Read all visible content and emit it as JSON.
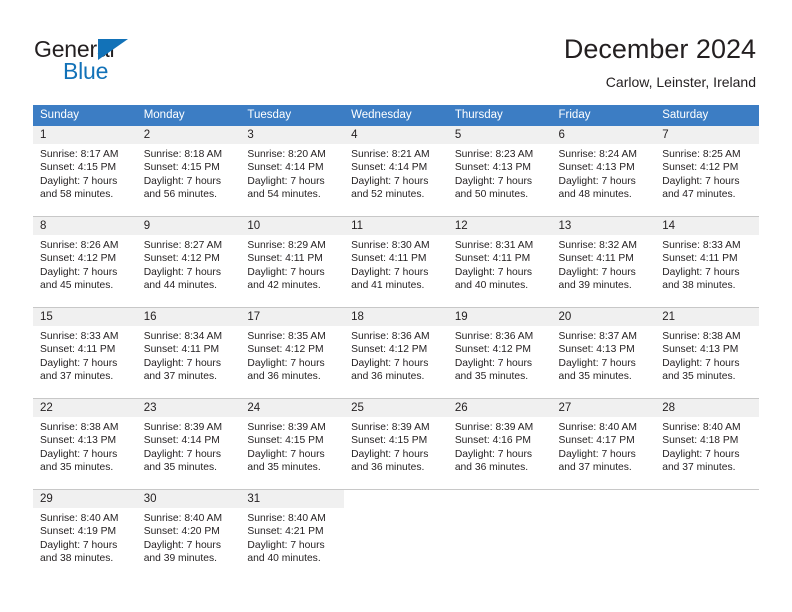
{
  "logo": {
    "word_top": "General",
    "word_bottom": "Blue",
    "triangle_color": "#1272b8"
  },
  "header": {
    "title": "December 2024",
    "subtitle": "Carlow, Leinster, Ireland"
  },
  "theme": {
    "header_row_bg": "#3c7dc4",
    "daynum_bg": "#f0f0f0",
    "text": "#231f20",
    "separator": "#c8c8c8"
  },
  "weekdays": [
    "Sunday",
    "Monday",
    "Tuesday",
    "Wednesday",
    "Thursday",
    "Friday",
    "Saturday"
  ],
  "weeks": [
    [
      {
        "day": "1",
        "sunrise": "Sunrise: 8:17 AM",
        "sunset": "Sunset: 4:15 PM",
        "daylight1": "Daylight: 7 hours",
        "daylight2": "and 58 minutes."
      },
      {
        "day": "2",
        "sunrise": "Sunrise: 8:18 AM",
        "sunset": "Sunset: 4:15 PM",
        "daylight1": "Daylight: 7 hours",
        "daylight2": "and 56 minutes."
      },
      {
        "day": "3",
        "sunrise": "Sunrise: 8:20 AM",
        "sunset": "Sunset: 4:14 PM",
        "daylight1": "Daylight: 7 hours",
        "daylight2": "and 54 minutes."
      },
      {
        "day": "4",
        "sunrise": "Sunrise: 8:21 AM",
        "sunset": "Sunset: 4:14 PM",
        "daylight1": "Daylight: 7 hours",
        "daylight2": "and 52 minutes."
      },
      {
        "day": "5",
        "sunrise": "Sunrise: 8:23 AM",
        "sunset": "Sunset: 4:13 PM",
        "daylight1": "Daylight: 7 hours",
        "daylight2": "and 50 minutes."
      },
      {
        "day": "6",
        "sunrise": "Sunrise: 8:24 AM",
        "sunset": "Sunset: 4:13 PM",
        "daylight1": "Daylight: 7 hours",
        "daylight2": "and 48 minutes."
      },
      {
        "day": "7",
        "sunrise": "Sunrise: 8:25 AM",
        "sunset": "Sunset: 4:12 PM",
        "daylight1": "Daylight: 7 hours",
        "daylight2": "and 47 minutes."
      }
    ],
    [
      {
        "day": "8",
        "sunrise": "Sunrise: 8:26 AM",
        "sunset": "Sunset: 4:12 PM",
        "daylight1": "Daylight: 7 hours",
        "daylight2": "and 45 minutes."
      },
      {
        "day": "9",
        "sunrise": "Sunrise: 8:27 AM",
        "sunset": "Sunset: 4:12 PM",
        "daylight1": "Daylight: 7 hours",
        "daylight2": "and 44 minutes."
      },
      {
        "day": "10",
        "sunrise": "Sunrise: 8:29 AM",
        "sunset": "Sunset: 4:11 PM",
        "daylight1": "Daylight: 7 hours",
        "daylight2": "and 42 minutes."
      },
      {
        "day": "11",
        "sunrise": "Sunrise: 8:30 AM",
        "sunset": "Sunset: 4:11 PM",
        "daylight1": "Daylight: 7 hours",
        "daylight2": "and 41 minutes."
      },
      {
        "day": "12",
        "sunrise": "Sunrise: 8:31 AM",
        "sunset": "Sunset: 4:11 PM",
        "daylight1": "Daylight: 7 hours",
        "daylight2": "and 40 minutes."
      },
      {
        "day": "13",
        "sunrise": "Sunrise: 8:32 AM",
        "sunset": "Sunset: 4:11 PM",
        "daylight1": "Daylight: 7 hours",
        "daylight2": "and 39 minutes."
      },
      {
        "day": "14",
        "sunrise": "Sunrise: 8:33 AM",
        "sunset": "Sunset: 4:11 PM",
        "daylight1": "Daylight: 7 hours",
        "daylight2": "and 38 minutes."
      }
    ],
    [
      {
        "day": "15",
        "sunrise": "Sunrise: 8:33 AM",
        "sunset": "Sunset: 4:11 PM",
        "daylight1": "Daylight: 7 hours",
        "daylight2": "and 37 minutes."
      },
      {
        "day": "16",
        "sunrise": "Sunrise: 8:34 AM",
        "sunset": "Sunset: 4:11 PM",
        "daylight1": "Daylight: 7 hours",
        "daylight2": "and 37 minutes."
      },
      {
        "day": "17",
        "sunrise": "Sunrise: 8:35 AM",
        "sunset": "Sunset: 4:12 PM",
        "daylight1": "Daylight: 7 hours",
        "daylight2": "and 36 minutes."
      },
      {
        "day": "18",
        "sunrise": "Sunrise: 8:36 AM",
        "sunset": "Sunset: 4:12 PM",
        "daylight1": "Daylight: 7 hours",
        "daylight2": "and 36 minutes."
      },
      {
        "day": "19",
        "sunrise": "Sunrise: 8:36 AM",
        "sunset": "Sunset: 4:12 PM",
        "daylight1": "Daylight: 7 hours",
        "daylight2": "and 35 minutes."
      },
      {
        "day": "20",
        "sunrise": "Sunrise: 8:37 AM",
        "sunset": "Sunset: 4:13 PM",
        "daylight1": "Daylight: 7 hours",
        "daylight2": "and 35 minutes."
      },
      {
        "day": "21",
        "sunrise": "Sunrise: 8:38 AM",
        "sunset": "Sunset: 4:13 PM",
        "daylight1": "Daylight: 7 hours",
        "daylight2": "and 35 minutes."
      }
    ],
    [
      {
        "day": "22",
        "sunrise": "Sunrise: 8:38 AM",
        "sunset": "Sunset: 4:13 PM",
        "daylight1": "Daylight: 7 hours",
        "daylight2": "and 35 minutes."
      },
      {
        "day": "23",
        "sunrise": "Sunrise: 8:39 AM",
        "sunset": "Sunset: 4:14 PM",
        "daylight1": "Daylight: 7 hours",
        "daylight2": "and 35 minutes."
      },
      {
        "day": "24",
        "sunrise": "Sunrise: 8:39 AM",
        "sunset": "Sunset: 4:15 PM",
        "daylight1": "Daylight: 7 hours",
        "daylight2": "and 35 minutes."
      },
      {
        "day": "25",
        "sunrise": "Sunrise: 8:39 AM",
        "sunset": "Sunset: 4:15 PM",
        "daylight1": "Daylight: 7 hours",
        "daylight2": "and 36 minutes."
      },
      {
        "day": "26",
        "sunrise": "Sunrise: 8:39 AM",
        "sunset": "Sunset: 4:16 PM",
        "daylight1": "Daylight: 7 hours",
        "daylight2": "and 36 minutes."
      },
      {
        "day": "27",
        "sunrise": "Sunrise: 8:40 AM",
        "sunset": "Sunset: 4:17 PM",
        "daylight1": "Daylight: 7 hours",
        "daylight2": "and 37 minutes."
      },
      {
        "day": "28",
        "sunrise": "Sunrise: 8:40 AM",
        "sunset": "Sunset: 4:18 PM",
        "daylight1": "Daylight: 7 hours",
        "daylight2": "and 37 minutes."
      }
    ],
    [
      {
        "day": "29",
        "sunrise": "Sunrise: 8:40 AM",
        "sunset": "Sunset: 4:19 PM",
        "daylight1": "Daylight: 7 hours",
        "daylight2": "and 38 minutes."
      },
      {
        "day": "30",
        "sunrise": "Sunrise: 8:40 AM",
        "sunset": "Sunset: 4:20 PM",
        "daylight1": "Daylight: 7 hours",
        "daylight2": "and 39 minutes."
      },
      {
        "day": "31",
        "sunrise": "Sunrise: 8:40 AM",
        "sunset": "Sunset: 4:21 PM",
        "daylight1": "Daylight: 7 hours",
        "daylight2": "and 40 minutes."
      },
      {
        "day": "",
        "sunrise": "",
        "sunset": "",
        "daylight1": "",
        "daylight2": ""
      },
      {
        "day": "",
        "sunrise": "",
        "sunset": "",
        "daylight1": "",
        "daylight2": ""
      },
      {
        "day": "",
        "sunrise": "",
        "sunset": "",
        "daylight1": "",
        "daylight2": ""
      },
      {
        "day": "",
        "sunrise": "",
        "sunset": "",
        "daylight1": "",
        "daylight2": ""
      }
    ]
  ]
}
